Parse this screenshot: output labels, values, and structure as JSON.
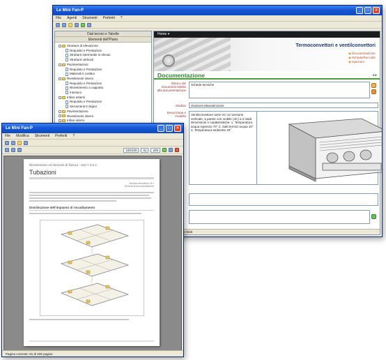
{
  "back_window": {
    "title": "Le Mini Fan-P",
    "menu": [
      "File",
      "Agenti",
      "Strumenti",
      "Preferiti",
      "?"
    ],
    "tree": {
      "head1": "Dati tecnici e Tabelle",
      "head2": "Elementi dell'Piano",
      "items": [
        {
          "kind": "folder",
          "label": "Strutture di elevazione"
        },
        {
          "kind": "doc",
          "label": "Requisito e Prestazioni"
        },
        {
          "kind": "doc",
          "label": "Strutture intermedie in elevaz."
        },
        {
          "kind": "doc",
          "label": "Strutture verticali"
        },
        {
          "kind": "folder",
          "label": "Pavimentazioni"
        },
        {
          "kind": "doc",
          "label": "Requisito e Prestazioni"
        },
        {
          "kind": "doc",
          "label": "Materiali ti costitui"
        },
        {
          "kind": "folder",
          "label": "Rivestimenti interni"
        },
        {
          "kind": "doc",
          "label": "Requisito e Prestazioni"
        },
        {
          "kind": "doc",
          "label": "Rivestimento a cappotto"
        },
        {
          "kind": "doc",
          "label": "Intonaco"
        },
        {
          "kind": "folder",
          "label": "Infissi esterni"
        },
        {
          "kind": "doc",
          "label": "Requisito e Prestazioni"
        },
        {
          "kind": "doc",
          "label": "Serramenti in legno"
        },
        {
          "kind": "folder",
          "label": "Pavimentazioni"
        },
        {
          "kind": "folder",
          "label": "Rivestimenti interni"
        },
        {
          "kind": "folder",
          "label": "Infissi interni"
        },
        {
          "kind": "folder",
          "label": "Impianti"
        }
      ]
    },
    "navbar": "Home ▾",
    "banner_title": "Termoconvettori e ventilconvettori",
    "banner_links": [
      "Documentazione",
      "Schede/Raccolte",
      "Ispezioni"
    ],
    "section_title": "Documentazione",
    "section_arrows": "◂ ▸",
    "fields": {
      "elenco_label": "Elenco dei documenti relativi alla documentazione",
      "elenco_value": "Schede tecniche",
      "modulo_label": "Modulo",
      "modulo_value": "Gestione Manutenzione",
      "descr_label": "Descrizione e modello",
      "descr_value": "Ventilconvettore serie VC-12 versione verticale, a parete con mobile (4C) a 2 stadi. Dimensioni e caratteristiche: 1. Temperatura acqua ingresso 70° 2. Salti termici acqua 10° 3. Temperatura ambiente 20°"
    },
    "status": "Fatto | Reindirizzato Web"
  },
  "front_window": {
    "title": "Le Mini Fan-P",
    "menu": [
      "File",
      "Modifica",
      "Strumenti",
      "Preferiti",
      "?"
    ],
    "toolbar_zoom": "100/100",
    "toolbar_page": "81",
    "toolbar_total": "209",
    "page": {
      "header": "Rivestimento ed elementi di finitura - UNI 7.3.2.2",
      "title": "Tubazioni",
      "meta1": "Scheda descrittiva: B.1",
      "meta2": "Scheda di documentazione",
      "subheading": "Distribuzione dell'impianto di riscaldamento"
    },
    "status": "Pagina corrente: 81 di 209 pagine"
  },
  "colors": {
    "xp_blue": "#1556d6",
    "section_green": "#2d8a2a",
    "label_red": "#9c2a2a"
  }
}
